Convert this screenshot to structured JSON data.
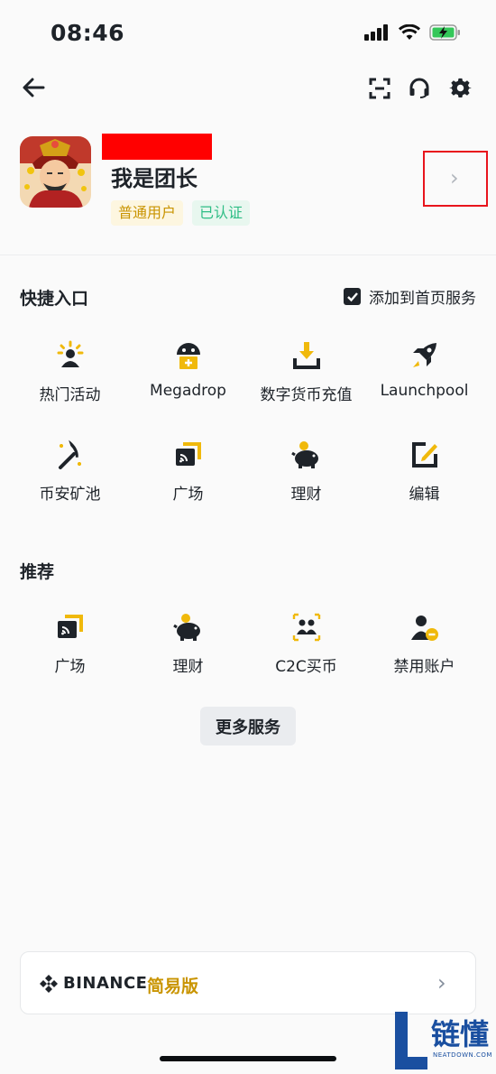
{
  "status": {
    "time": "08:46"
  },
  "profile": {
    "username": "我是团长",
    "badge_user_type": "普通用户",
    "badge_verified": "已认证"
  },
  "quick_access": {
    "title": "快捷入口",
    "add_to_home_label": "添加到首页服务",
    "items": [
      {
        "label": "热门活动",
        "icon": "hot-activity-icon"
      },
      {
        "label": "Megadrop",
        "icon": "megadrop-icon"
      },
      {
        "label": "数字货币充值",
        "icon": "deposit-icon"
      },
      {
        "label": "Launchpool",
        "icon": "rocket-icon"
      },
      {
        "label": "币安矿池",
        "icon": "pickaxe-icon"
      },
      {
        "label": "广场",
        "icon": "square-feed-icon"
      },
      {
        "label": "理财",
        "icon": "piggy-bank-icon"
      },
      {
        "label": "编辑",
        "icon": "edit-icon"
      }
    ]
  },
  "recommended": {
    "title": "推荐",
    "items": [
      {
        "label": "广场",
        "icon": "square-feed-icon"
      },
      {
        "label": "理财",
        "icon": "piggy-bank-icon"
      },
      {
        "label": "C2C买币",
        "icon": "c2c-users-icon"
      },
      {
        "label": "禁用账户",
        "icon": "disable-account-icon"
      }
    ]
  },
  "more_services_label": "更多服务",
  "binance_lite": {
    "brand": "BINANCE",
    "mode": "简易版"
  },
  "watermark": {
    "text": "链懂",
    "sub": "NEATDOWN.COM"
  },
  "colors": {
    "accent": "#f0b90b",
    "text": "#1e2329",
    "highlight_box": "#e8141c"
  }
}
